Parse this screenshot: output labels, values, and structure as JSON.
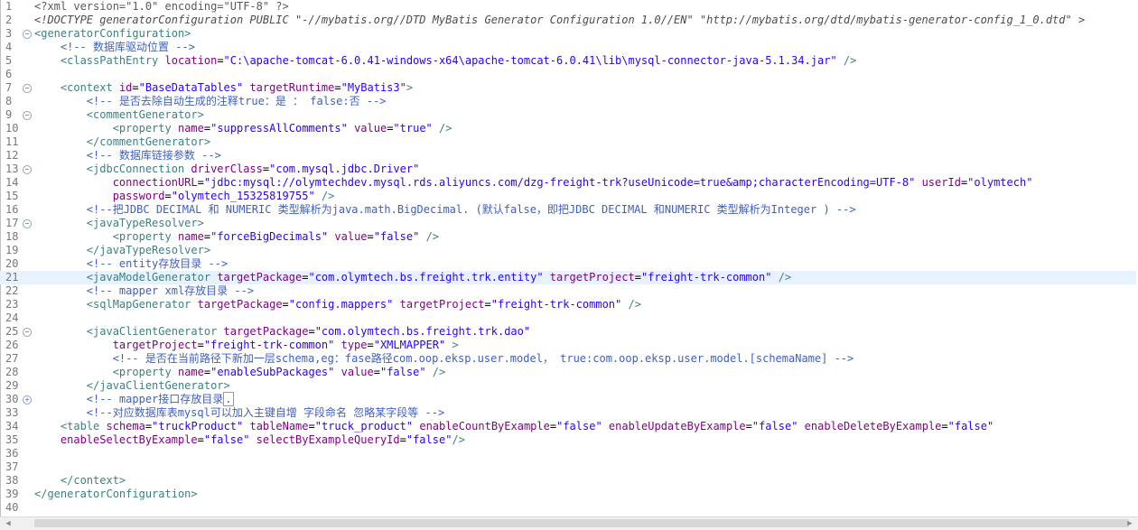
{
  "editor": {
    "current_line": 21,
    "lines": [
      {
        "n": "1",
        "fold": "",
        "indent": "",
        "segs": [
          {
            "k": "pi",
            "t": "<?xml version=\"1.0\" encoding=\"UTF-8\" ?>"
          }
        ]
      },
      {
        "n": "2",
        "fold": "",
        "indent": "",
        "segs": [
          {
            "k": "doctype",
            "t": "<!DOCTYPE generatorConfiguration PUBLIC \"-//mybatis.org//DTD MyBatis Generator Configuration 1.0//EN\" \"http://mybatis.org/dtd/mybatis-generator-config_1_0.dtd\" >"
          }
        ]
      },
      {
        "n": "3",
        "fold": "minus",
        "indent": "",
        "segs": [
          {
            "k": "tag",
            "t": "<generatorConfiguration>"
          }
        ]
      },
      {
        "n": "4",
        "fold": "",
        "indent": "    ",
        "segs": [
          {
            "k": "com",
            "t": "<!-- 数据库驱动位置 -->"
          }
        ]
      },
      {
        "n": "5",
        "fold": "",
        "indent": "    ",
        "segs": [
          {
            "k": "tag",
            "t": "<classPathEntry"
          },
          {
            "k": "plain",
            "t": " "
          },
          {
            "k": "attr",
            "t": "location"
          },
          {
            "k": "plain",
            "t": "="
          },
          {
            "k": "val",
            "t": "\"C:\\apache-tomcat-6.0.41-windows-x64\\apache-tomcat-6.0.41\\lib\\mysql-connector-java-5.1.34.jar\""
          },
          {
            "k": "plain",
            "t": " "
          },
          {
            "k": "tag",
            "t": "/>"
          }
        ]
      },
      {
        "n": "6",
        "fold": "",
        "indent": "",
        "segs": []
      },
      {
        "n": "7",
        "fold": "minus",
        "indent": "    ",
        "segs": [
          {
            "k": "tag",
            "t": "<context"
          },
          {
            "k": "plain",
            "t": " "
          },
          {
            "k": "attr",
            "t": "id"
          },
          {
            "k": "plain",
            "t": "="
          },
          {
            "k": "val",
            "t": "\"BaseDataTables\""
          },
          {
            "k": "plain",
            "t": " "
          },
          {
            "k": "attr",
            "t": "targetRuntime"
          },
          {
            "k": "plain",
            "t": "="
          },
          {
            "k": "val",
            "t": "\"MyBatis3\""
          },
          {
            "k": "tag",
            "t": ">"
          }
        ]
      },
      {
        "n": "8",
        "fold": "",
        "indent": "        ",
        "segs": [
          {
            "k": "com",
            "t": "<!-- 是否去除自动生成的注释true：是 ： false:否 -->"
          }
        ]
      },
      {
        "n": "9",
        "fold": "minus",
        "indent": "        ",
        "segs": [
          {
            "k": "tag",
            "t": "<commentGenerator>"
          }
        ]
      },
      {
        "n": "10",
        "fold": "",
        "indent": "            ",
        "segs": [
          {
            "k": "tag",
            "t": "<property"
          },
          {
            "k": "plain",
            "t": " "
          },
          {
            "k": "attr",
            "t": "name"
          },
          {
            "k": "plain",
            "t": "="
          },
          {
            "k": "val",
            "t": "\"suppressAllComments\""
          },
          {
            "k": "plain",
            "t": " "
          },
          {
            "k": "attr",
            "t": "value"
          },
          {
            "k": "plain",
            "t": "="
          },
          {
            "k": "val",
            "t": "\"true\""
          },
          {
            "k": "plain",
            "t": " "
          },
          {
            "k": "tag",
            "t": "/>"
          }
        ]
      },
      {
        "n": "11",
        "fold": "",
        "indent": "        ",
        "segs": [
          {
            "k": "tag",
            "t": "</commentGenerator>"
          }
        ]
      },
      {
        "n": "12",
        "fold": "",
        "indent": "        ",
        "segs": [
          {
            "k": "com",
            "t": "<!-- 数据库链接参数 -->"
          }
        ]
      },
      {
        "n": "13",
        "fold": "minus",
        "indent": "        ",
        "segs": [
          {
            "k": "tag",
            "t": "<jdbcConnection"
          },
          {
            "k": "plain",
            "t": " "
          },
          {
            "k": "attr",
            "t": "driverClass"
          },
          {
            "k": "plain",
            "t": "="
          },
          {
            "k": "val",
            "t": "\"com.mysql.jdbc.Driver\""
          }
        ]
      },
      {
        "n": "14",
        "fold": "",
        "indent": "            ",
        "segs": [
          {
            "k": "attr",
            "t": "connectionURL"
          },
          {
            "k": "plain",
            "t": "="
          },
          {
            "k": "val",
            "t": "\"jdbc:mysql://olymtechdev.mysql.rds.aliyuncs.com/dzg-freight-trk?useUnicode=true&amp;characterEncoding=UTF-8\""
          },
          {
            "k": "plain",
            "t": " "
          },
          {
            "k": "attr",
            "t": "userId"
          },
          {
            "k": "plain",
            "t": "="
          },
          {
            "k": "val",
            "t": "\"olymtech\""
          }
        ]
      },
      {
        "n": "15",
        "fold": "",
        "indent": "            ",
        "segs": [
          {
            "k": "attr",
            "t": "password"
          },
          {
            "k": "plain",
            "t": "="
          },
          {
            "k": "val",
            "t": "\"olymtech_15325819755\""
          },
          {
            "k": "plain",
            "t": " "
          },
          {
            "k": "tag",
            "t": "/>"
          }
        ]
      },
      {
        "n": "16",
        "fold": "",
        "indent": "        ",
        "segs": [
          {
            "k": "com",
            "t": "<!--把JDBC DECIMAL 和 NUMERIC 类型解析为java.math.BigDecimal. (默认false，即把JDBC DECIMAL 和NUMERIC 类型解析为Integer ) -->"
          }
        ]
      },
      {
        "n": "17",
        "fold": "minus",
        "indent": "        ",
        "segs": [
          {
            "k": "tag",
            "t": "<javaTypeResolver>"
          }
        ]
      },
      {
        "n": "18",
        "fold": "",
        "indent": "            ",
        "segs": [
          {
            "k": "tag",
            "t": "<property"
          },
          {
            "k": "plain",
            "t": " "
          },
          {
            "k": "attr",
            "t": "name"
          },
          {
            "k": "plain",
            "t": "="
          },
          {
            "k": "val",
            "t": "\"forceBigDecimals\""
          },
          {
            "k": "plain",
            "t": " "
          },
          {
            "k": "attr",
            "t": "value"
          },
          {
            "k": "plain",
            "t": "="
          },
          {
            "k": "val",
            "t": "\"false\""
          },
          {
            "k": "plain",
            "t": " "
          },
          {
            "k": "tag",
            "t": "/>"
          }
        ]
      },
      {
        "n": "19",
        "fold": "",
        "indent": "        ",
        "segs": [
          {
            "k": "tag",
            "t": "</javaTypeResolver>"
          }
        ]
      },
      {
        "n": "20",
        "fold": "",
        "indent": "        ",
        "segs": [
          {
            "k": "com",
            "t": "<!-- entity存放目录 -->"
          }
        ]
      },
      {
        "n": "21",
        "fold": "",
        "indent": "        ",
        "segs": [
          {
            "k": "tag",
            "t": "<javaModelGenerator"
          },
          {
            "k": "plain",
            "t": " "
          },
          {
            "k": "attr",
            "t": "targetPackage"
          },
          {
            "k": "plain",
            "t": "="
          },
          {
            "k": "val",
            "t": "\"com.olymtech.bs.freight.trk.entity\""
          },
          {
            "k": "plain",
            "t": " "
          },
          {
            "k": "attr",
            "t": "targetProject"
          },
          {
            "k": "plain",
            "t": "="
          },
          {
            "k": "val",
            "t": "\"freight-trk-common\""
          },
          {
            "k": "plain",
            "t": " "
          },
          {
            "k": "tag",
            "t": "/>"
          }
        ]
      },
      {
        "n": "22",
        "fold": "",
        "indent": "        ",
        "segs": [
          {
            "k": "com",
            "t": "<!-- mapper xml存放目录 -->"
          }
        ]
      },
      {
        "n": "23",
        "fold": "",
        "indent": "        ",
        "segs": [
          {
            "k": "tag",
            "t": "<sqlMapGenerator"
          },
          {
            "k": "plain",
            "t": " "
          },
          {
            "k": "attr",
            "t": "targetPackage"
          },
          {
            "k": "plain",
            "t": "="
          },
          {
            "k": "val",
            "t": "\"config.mappers\""
          },
          {
            "k": "plain",
            "t": " "
          },
          {
            "k": "attr",
            "t": "targetProject"
          },
          {
            "k": "plain",
            "t": "="
          },
          {
            "k": "val",
            "t": "\"freight-trk-common\""
          },
          {
            "k": "plain",
            "t": " "
          },
          {
            "k": "tag",
            "t": "/>"
          }
        ]
      },
      {
        "n": "24",
        "fold": "",
        "indent": "",
        "segs": []
      },
      {
        "n": "25",
        "fold": "minus",
        "indent": "        ",
        "segs": [
          {
            "k": "tag",
            "t": "<javaClientGenerator"
          },
          {
            "k": "plain",
            "t": " "
          },
          {
            "k": "attr",
            "t": "targetPackage"
          },
          {
            "k": "plain",
            "t": "="
          },
          {
            "k": "val",
            "t": "\"com.olymtech.bs.freight.trk.dao\""
          }
        ]
      },
      {
        "n": "26",
        "fold": "",
        "indent": "            ",
        "segs": [
          {
            "k": "attr",
            "t": "targetProject"
          },
          {
            "k": "plain",
            "t": "="
          },
          {
            "k": "val",
            "t": "\"freight-trk-common\""
          },
          {
            "k": "plain",
            "t": " "
          },
          {
            "k": "attr",
            "t": "type"
          },
          {
            "k": "plain",
            "t": "="
          },
          {
            "k": "val",
            "t": "\"XMLMAPPER\""
          },
          {
            "k": "plain",
            "t": " "
          },
          {
            "k": "tag",
            "t": ">"
          }
        ]
      },
      {
        "n": "27",
        "fold": "",
        "indent": "            ",
        "segs": [
          {
            "k": "com",
            "t": "<!-- 是否在当前路径下新加一层schema,eg：fase路径com.oop.eksp.user.model， true:com.oop.eksp.user.model.[schemaName] -->"
          }
        ]
      },
      {
        "n": "28",
        "fold": "",
        "indent": "            ",
        "segs": [
          {
            "k": "tag",
            "t": "<property"
          },
          {
            "k": "plain",
            "t": " "
          },
          {
            "k": "attr",
            "t": "name"
          },
          {
            "k": "plain",
            "t": "="
          },
          {
            "k": "val",
            "t": "\"enableSubPackages\""
          },
          {
            "k": "plain",
            "t": " "
          },
          {
            "k": "attr",
            "t": "value"
          },
          {
            "k": "plain",
            "t": "="
          },
          {
            "k": "val",
            "t": "\"false\""
          },
          {
            "k": "plain",
            "t": " "
          },
          {
            "k": "tag",
            "t": "/>"
          }
        ]
      },
      {
        "n": "29",
        "fold": "",
        "indent": "        ",
        "segs": [
          {
            "k": "tag",
            "t": "</javaClientGenerator>"
          }
        ]
      },
      {
        "n": "30",
        "fold": "plus",
        "indent": "        ",
        "segs": [
          {
            "k": "com",
            "t": "<!-- mapper接口存放目录"
          },
          {
            "k": "fold",
            "t": "."
          }
        ]
      },
      {
        "n": "33",
        "fold": "",
        "indent": "        ",
        "segs": [
          {
            "k": "com",
            "t": "<!--对应数据库表mysql可以加入主键自增 字段命名 忽略某字段等 -->"
          }
        ]
      },
      {
        "n": "34",
        "fold": "",
        "indent": "    ",
        "segs": [
          {
            "k": "tag",
            "t": "<table"
          },
          {
            "k": "plain",
            "t": " "
          },
          {
            "k": "attr",
            "t": "schema"
          },
          {
            "k": "plain",
            "t": "="
          },
          {
            "k": "val",
            "t": "\"truckProduct\""
          },
          {
            "k": "plain",
            "t": " "
          },
          {
            "k": "attr",
            "t": "tableName"
          },
          {
            "k": "plain",
            "t": "="
          },
          {
            "k": "val",
            "t": "\"truck_product\""
          },
          {
            "k": "plain",
            "t": " "
          },
          {
            "k": "attr",
            "t": "enableCountByExample"
          },
          {
            "k": "plain",
            "t": "="
          },
          {
            "k": "val",
            "t": "\"false\""
          },
          {
            "k": "plain",
            "t": " "
          },
          {
            "k": "attr",
            "t": "enableUpdateByExample"
          },
          {
            "k": "plain",
            "t": "="
          },
          {
            "k": "val",
            "t": "\"false\""
          },
          {
            "k": "plain",
            "t": " "
          },
          {
            "k": "attr",
            "t": "enableDeleteByExample"
          },
          {
            "k": "plain",
            "t": "="
          },
          {
            "k": "val",
            "t": "\"false\""
          }
        ]
      },
      {
        "n": "35",
        "fold": "",
        "indent": "    ",
        "segs": [
          {
            "k": "attr",
            "t": "enableSelectByExample"
          },
          {
            "k": "plain",
            "t": "="
          },
          {
            "k": "val",
            "t": "\"false\""
          },
          {
            "k": "plain",
            "t": " "
          },
          {
            "k": "attr",
            "t": "selectByExampleQueryId"
          },
          {
            "k": "plain",
            "t": "="
          },
          {
            "k": "val",
            "t": "\"false\""
          },
          {
            "k": "tag",
            "t": "/>"
          }
        ]
      },
      {
        "n": "36",
        "fold": "",
        "indent": "",
        "segs": []
      },
      {
        "n": "37",
        "fold": "",
        "indent": "",
        "segs": []
      },
      {
        "n": "38",
        "fold": "",
        "indent": "    ",
        "segs": [
          {
            "k": "tag",
            "t": "</context>"
          }
        ]
      },
      {
        "n": "39",
        "fold": "",
        "indent": "",
        "segs": [
          {
            "k": "tag",
            "t": "</generatorConfiguration>"
          }
        ]
      },
      {
        "n": "40",
        "fold": "",
        "indent": "",
        "segs": []
      }
    ]
  },
  "scrollbar": {
    "left_arrow": "◀",
    "right_arrow": "▶"
  },
  "icons": {
    "fold_collapse": "minus-icon",
    "fold_expand": "plus-icon"
  },
  "colors": {
    "tag": "#3f7f7f",
    "attr": "#7f007f",
    "value": "#2a00ff",
    "comment": "#3f5fbf",
    "current_line": "#e8f2fe"
  }
}
